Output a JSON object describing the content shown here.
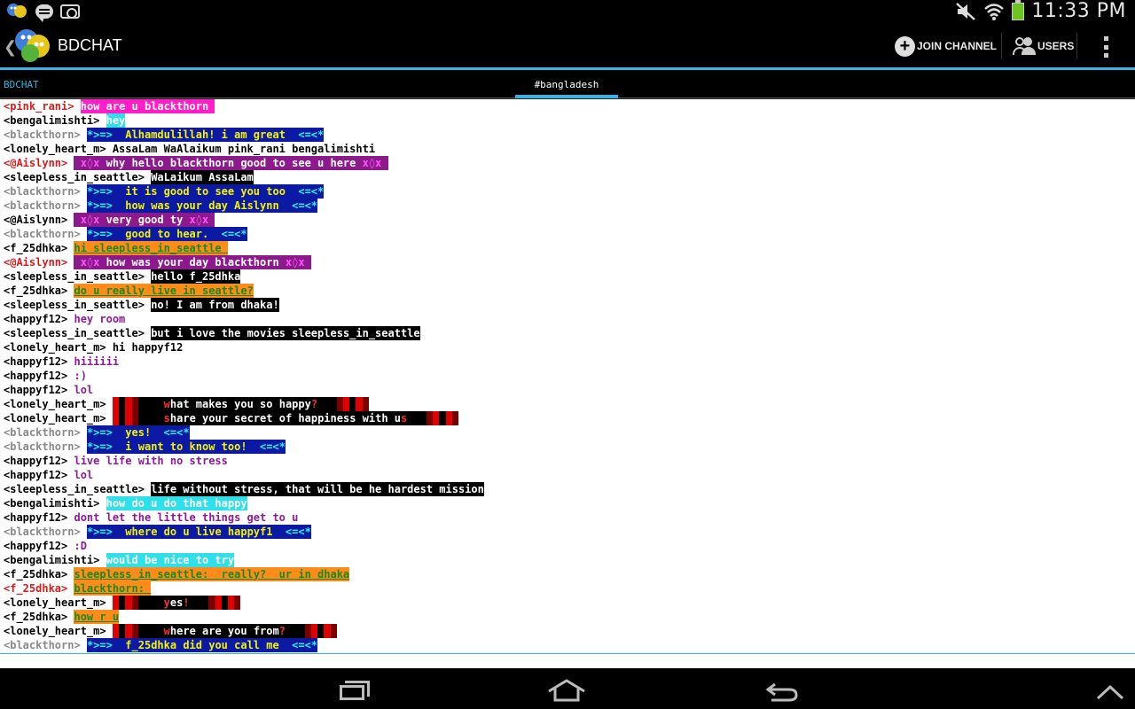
{
  "status_bar": {
    "time": "11:33 PM"
  },
  "app": {
    "title": "BDCHAT"
  },
  "actions": {
    "join_label": "JOIN CHANNEL",
    "users_label": "USERS"
  },
  "tabs": {
    "server": "BDCHAT",
    "active": "#bangladesh"
  },
  "colors": {
    "accent": "#33b5e5",
    "chat_bg": "#ffffff"
  },
  "messages": [
    {
      "nick": "<pink_rani>",
      "nick_style": "red",
      "style": "pink",
      "text": "how are u blackthorn "
    },
    {
      "nick": "<bengalimishti>",
      "nick_style": "black",
      "style": "cyan",
      "text": "hey"
    },
    {
      "nick": "<blackthorn>",
      "nick_style": "gray",
      "style": "navy",
      "pre": "*>=>  ",
      "text": "Alhamdulillah! i am great",
      "post": "  <=<*"
    },
    {
      "nick": "<lonely_heart_m>",
      "nick_style": "black",
      "style": "plain",
      "text": "AssaLam WaAlaikum pink_rani bengalimishti"
    },
    {
      "nick": "<@Aislynn>",
      "nick_style": "red",
      "style": "aisl",
      "pre": " x◊x ",
      "text": "why hello blackthorn good to see u here",
      "post": " x◊x "
    },
    {
      "nick": "<sleepless_in_seattle>",
      "nick_style": "black",
      "style": "black",
      "text": "WaLaikum AssaLam"
    },
    {
      "nick": "<blackthorn>",
      "nick_style": "gray",
      "style": "navy",
      "pre": "*>=>  ",
      "text": "it is good to see you too",
      "post": "  <=<*"
    },
    {
      "nick": "<blackthorn>",
      "nick_style": "gray",
      "style": "navy",
      "pre": "*>=>  ",
      "text": "how was your day Aislynn",
      "post": "  <=<*"
    },
    {
      "nick": "<@Aislynn>",
      "nick_style": "black",
      "style": "aisl",
      "pre": " x◊x ",
      "text": "very good ty",
      "post": " x◊x "
    },
    {
      "nick": "<blackthorn>",
      "nick_style": "gray",
      "style": "navy",
      "pre": "*>=>  ",
      "text": "good to hear.",
      "post": "  <=<*"
    },
    {
      "nick": "<f_25dhka>",
      "nick_style": "black",
      "style": "orange",
      "text": "hi sleepless_in_seattle "
    },
    {
      "nick": "<@Aislynn>",
      "nick_style": "red",
      "style": "aisl",
      "pre": " x◊x ",
      "text": "how was your day blackthorn",
      "post": " x◊x "
    },
    {
      "nick": "<sleepless_in_seattle>",
      "nick_style": "black",
      "style": "black",
      "text": "hello f_25dhka"
    },
    {
      "nick": "<f_25dhka>",
      "nick_style": "black",
      "style": "orange",
      "text": "do u really live in seattle?"
    },
    {
      "nick": "<sleepless_in_seattle>",
      "nick_style": "black",
      "style": "black",
      "text": "no! I am from dhaka!"
    },
    {
      "nick": "<happyf12>",
      "nick_style": "black",
      "style": "purple",
      "text": "hey room"
    },
    {
      "nick": "<sleepless_in_seattle>",
      "nick_style": "black",
      "style": "black",
      "text": "but i love the movies sleepless_in_seattle"
    },
    {
      "nick": "<lonely_heart_m>",
      "nick_style": "black",
      "style": "plain",
      "text": "hi happyf12"
    },
    {
      "nick": "<happyf12>",
      "nick_style": "black",
      "style": "purple",
      "text": "hiiiiii"
    },
    {
      "nick": "<happyf12>",
      "nick_style": "black",
      "style": "purple",
      "text": ":)"
    },
    {
      "nick": "<happyf12>",
      "nick_style": "black",
      "style": "purple",
      "text": "lol"
    },
    {
      "nick": "<lonely_heart_m>",
      "nick_style": "black",
      "style": "love",
      "first": "w",
      "text": "hat makes you so happy",
      "mark": "?"
    },
    {
      "nick": "<lonely_heart_m>",
      "nick_style": "black",
      "style": "love",
      "first": "s",
      "text": "hare your secret of happiness with u",
      "mark": "s"
    },
    {
      "nick": "<blackthorn>",
      "nick_style": "gray",
      "style": "navy",
      "pre": "*>=>  ",
      "text": "yes!",
      "post": "  <=<*"
    },
    {
      "nick": "<blackthorn>",
      "nick_style": "gray",
      "style": "navy",
      "pre": "*>=>  ",
      "text": "i want to know too!",
      "post": "  <=<*"
    },
    {
      "nick": "<happyf12>",
      "nick_style": "black",
      "style": "purple",
      "text": "live life with no stress"
    },
    {
      "nick": "<happyf12>",
      "nick_style": "black",
      "style": "purple",
      "text": "lol"
    },
    {
      "nick": "<sleepless_in_seattle>",
      "nick_style": "black",
      "style": "black",
      "text": "life without stress, that will be he hardest mission"
    },
    {
      "nick": "<bengalimishti>",
      "nick_style": "black",
      "style": "cyan",
      "text": "how do u do that happy"
    },
    {
      "nick": "<happyf12>",
      "nick_style": "black",
      "style": "purple",
      "text": "dont let the little things get to u"
    },
    {
      "nick": "<blackthorn>",
      "nick_style": "gray",
      "style": "navy",
      "pre": "*>=>  ",
      "text": "where do u live happyf1",
      "post": "  <=<*"
    },
    {
      "nick": "<happyf12>",
      "nick_style": "black",
      "style": "purple",
      "text": ":D"
    },
    {
      "nick": "<bengalimishti>",
      "nick_style": "black",
      "style": "cyan",
      "text": "would be nice to try"
    },
    {
      "nick": "<f_25dhka>",
      "nick_style": "black",
      "style": "orange",
      "text": "sleepless_in_seattle:  really?  ur in dhaka"
    },
    {
      "nick": "<f_25dhka>",
      "nick_style": "red",
      "style": "orange",
      "text": "blackthorn: "
    },
    {
      "nick": "<lonely_heart_m>",
      "nick_style": "black",
      "style": "love",
      "first": "y",
      "text": "es",
      "mark": "!"
    },
    {
      "nick": "<f_25dhka>",
      "nick_style": "black",
      "style": "orange",
      "text": "how r u"
    },
    {
      "nick": "<lonely_heart_m>",
      "nick_style": "black",
      "style": "love",
      "first": "w",
      "text": "here are you from",
      "mark": "?"
    },
    {
      "nick": "<blackthorn>",
      "nick_style": "gray",
      "style": "navy",
      "pre": "*>=>  ",
      "text": "f_25dhka did you call me",
      "post": "  <=<*"
    }
  ]
}
